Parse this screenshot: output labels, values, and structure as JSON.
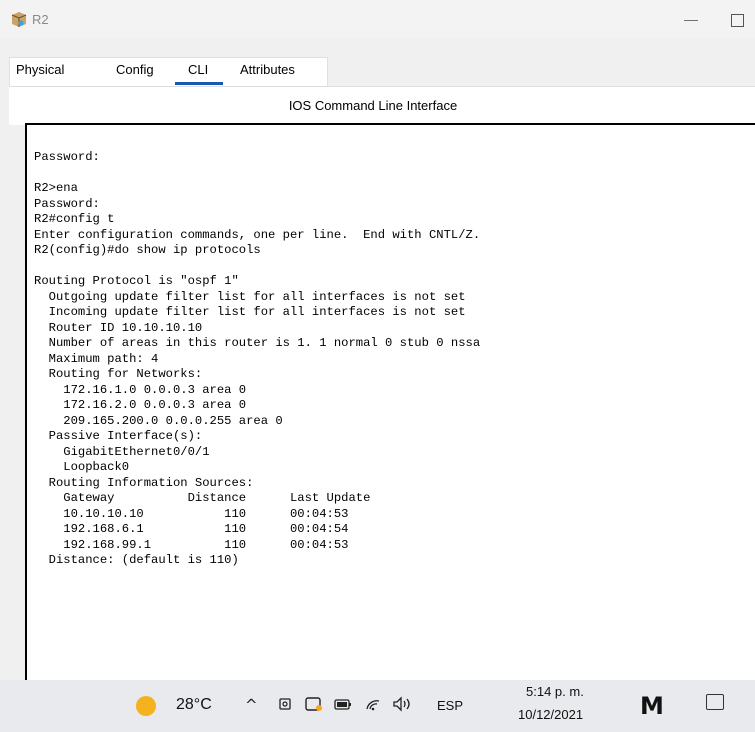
{
  "window": {
    "title": "R2",
    "minimize_glyph": "—"
  },
  "tabs": {
    "physical": "Physical",
    "config": "Config",
    "cli": "CLI",
    "attributes": "Attributes"
  },
  "panel": {
    "title": "IOS Command Line Interface"
  },
  "console": {
    "text": "Password:\n\nR2>ena\nPassword:\nR2#config t\nEnter configuration commands, one per line.  End with CNTL/Z.\nR2(config)#do show ip protocols\n\nRouting Protocol is \"ospf 1\"\n  Outgoing update filter list for all interfaces is not set\n  Incoming update filter list for all interfaces is not set\n  Router ID 10.10.10.10\n  Number of areas in this router is 1. 1 normal 0 stub 0 nssa\n  Maximum path: 4\n  Routing for Networks:\n    172.16.1.0 0.0.0.3 area 0\n    172.16.2.0 0.0.0.3 area 0\n    209.165.200.0 0.0.0.255 area 0\n  Passive Interface(s):\n    GigabitEthernet0/0/1\n    Loopback0\n  Routing Information Sources:\n    Gateway          Distance      Last Update\n    10.10.10.10           110      00:04:53\n    192.168.6.1           110      00:04:54\n    192.168.99.1          110      00:04:53\n  Distance: (default is 110)"
  },
  "taskbar": {
    "temperature": "28°C",
    "chevron": "^",
    "language": "ESP",
    "time": "5:14 p. m.",
    "date": "10/12/2021",
    "m_label": "M"
  },
  "colors": {
    "cli_tab_accent": "#1a57b0",
    "weather": "#f5b120"
  },
  "icons": [
    "router-icon",
    "sun-icon",
    "chevron-up-icon",
    "meet-icon",
    "app-icon",
    "battery-icon",
    "wifi-icon",
    "speaker-icon",
    "m-icon",
    "notification-icon"
  ]
}
